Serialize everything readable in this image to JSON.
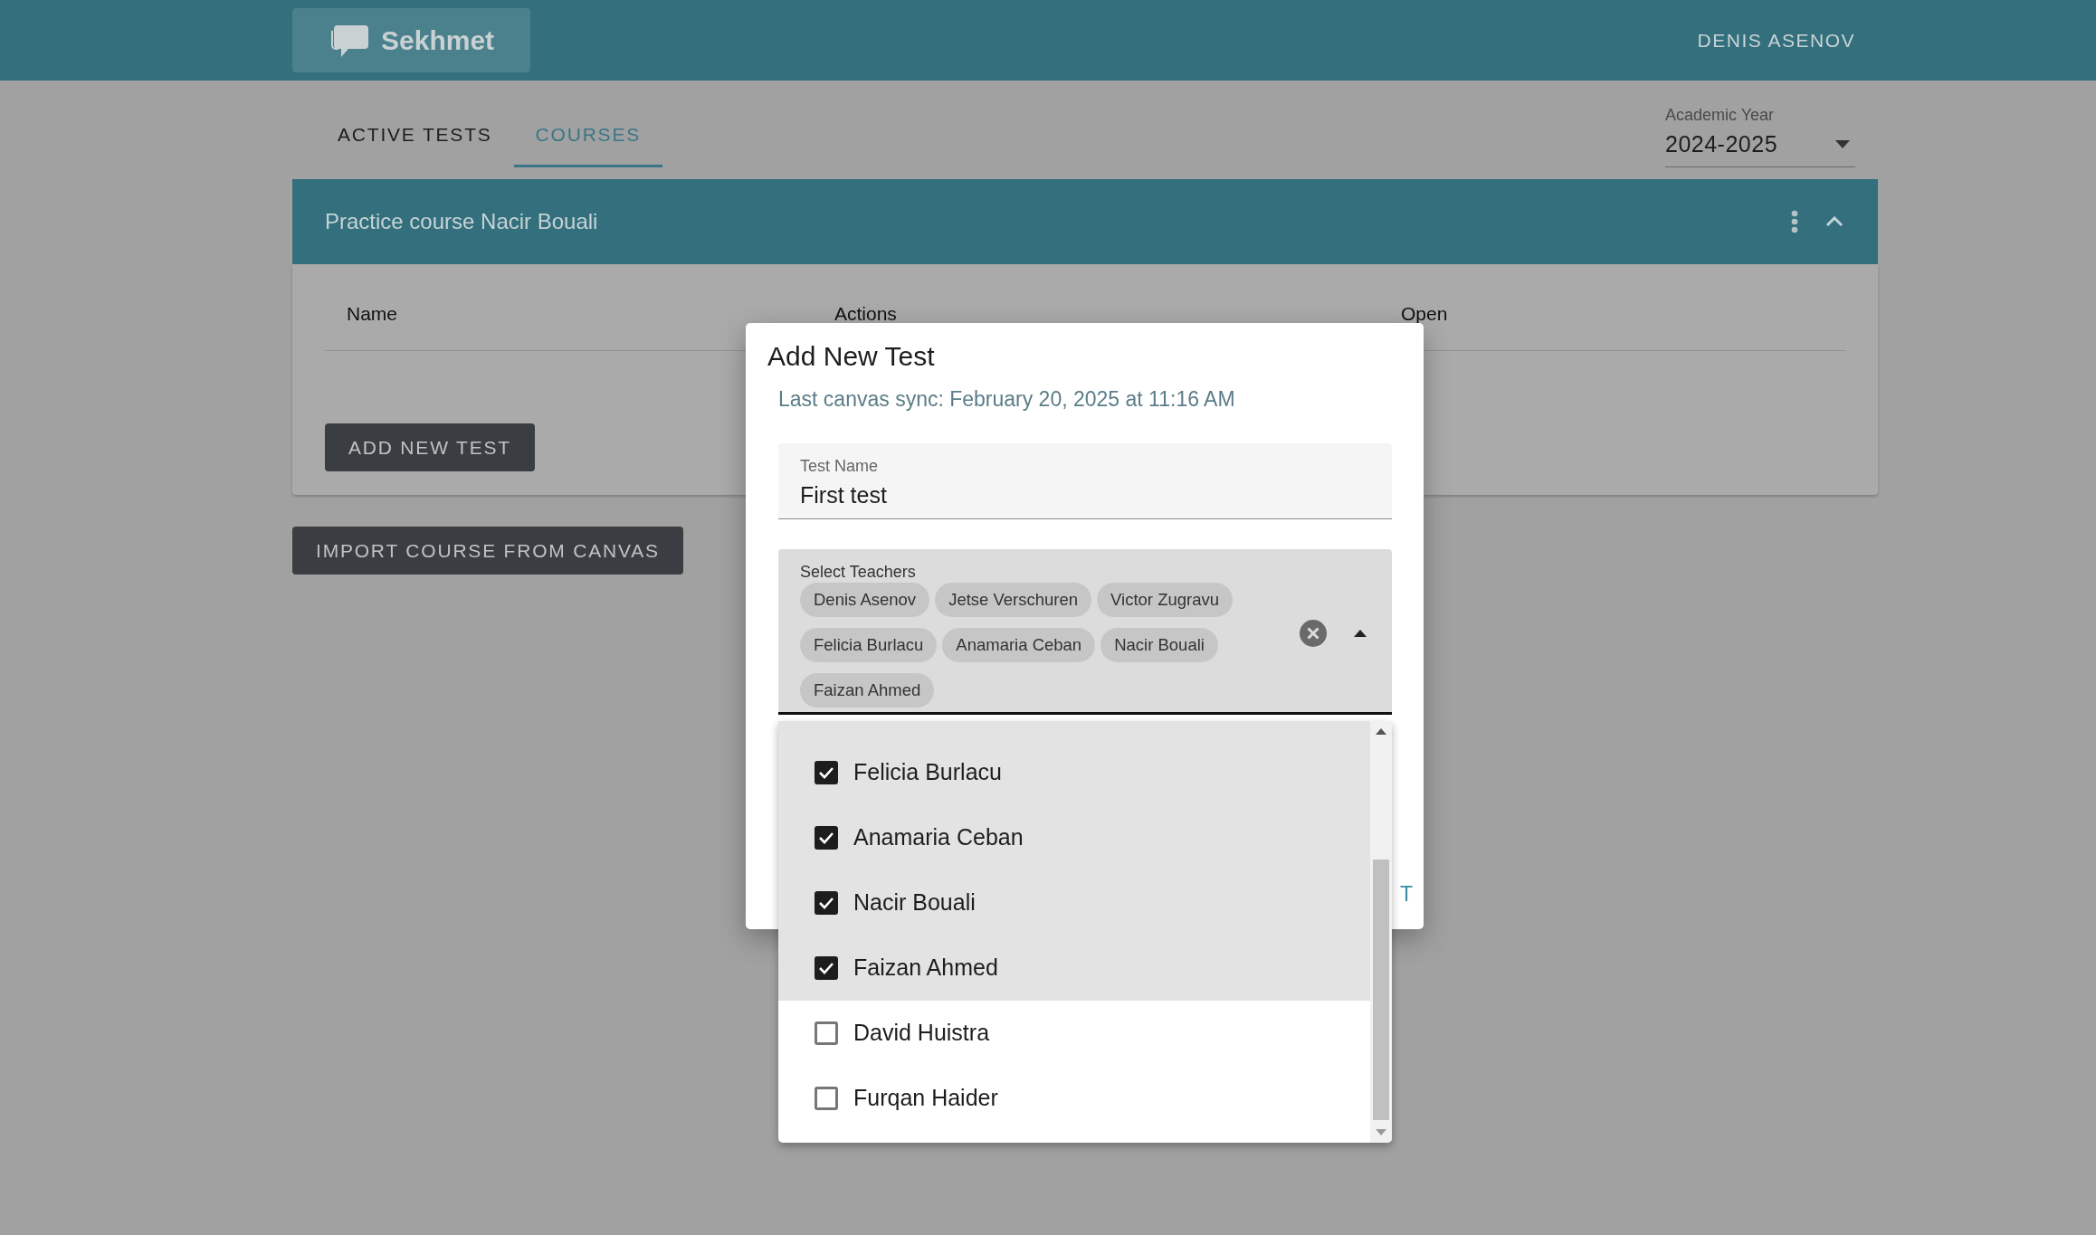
{
  "header": {
    "logo_text": "Sekhmet",
    "user": "DENIS ASENOV"
  },
  "tabs": [
    {
      "label": "ACTIVE TESTS",
      "selected": false
    },
    {
      "label": "COURSES",
      "selected": true
    }
  ],
  "academic_year": {
    "label": "Academic Year",
    "value": "2024-2025"
  },
  "course": {
    "title": "Practice course Nacir Bouali",
    "expanded": true,
    "columns": [
      "Name",
      "Actions",
      "Open"
    ],
    "add_button": "ADD NEW TEST"
  },
  "import_button": "IMPORT COURSE FROM CANVAS",
  "dialog": {
    "title": "Add New Test",
    "sync_text": "Last canvas sync: February 20, 2025 at 11:16 AM",
    "test_name": {
      "label": "Test Name",
      "value": "First test"
    },
    "teachers": {
      "label": "Select Teachers",
      "chips": [
        "Denis Asenov",
        "Jetse Verschuren",
        "Victor Zugravu",
        "Felicia Burlacu",
        "Anamaria Ceban",
        "Nacir Bouali",
        "Faizan Ahmed"
      ]
    },
    "action_button": "T"
  },
  "teacher_options": [
    {
      "name": "Felicia Burlacu",
      "checked": true
    },
    {
      "name": "Anamaria Ceban",
      "checked": true
    },
    {
      "name": "Nacir Bouali",
      "checked": true
    },
    {
      "name": "Faizan Ahmed",
      "checked": true
    },
    {
      "name": "David Huistra",
      "checked": false
    },
    {
      "name": "Furqan Haider",
      "checked": false
    }
  ]
}
